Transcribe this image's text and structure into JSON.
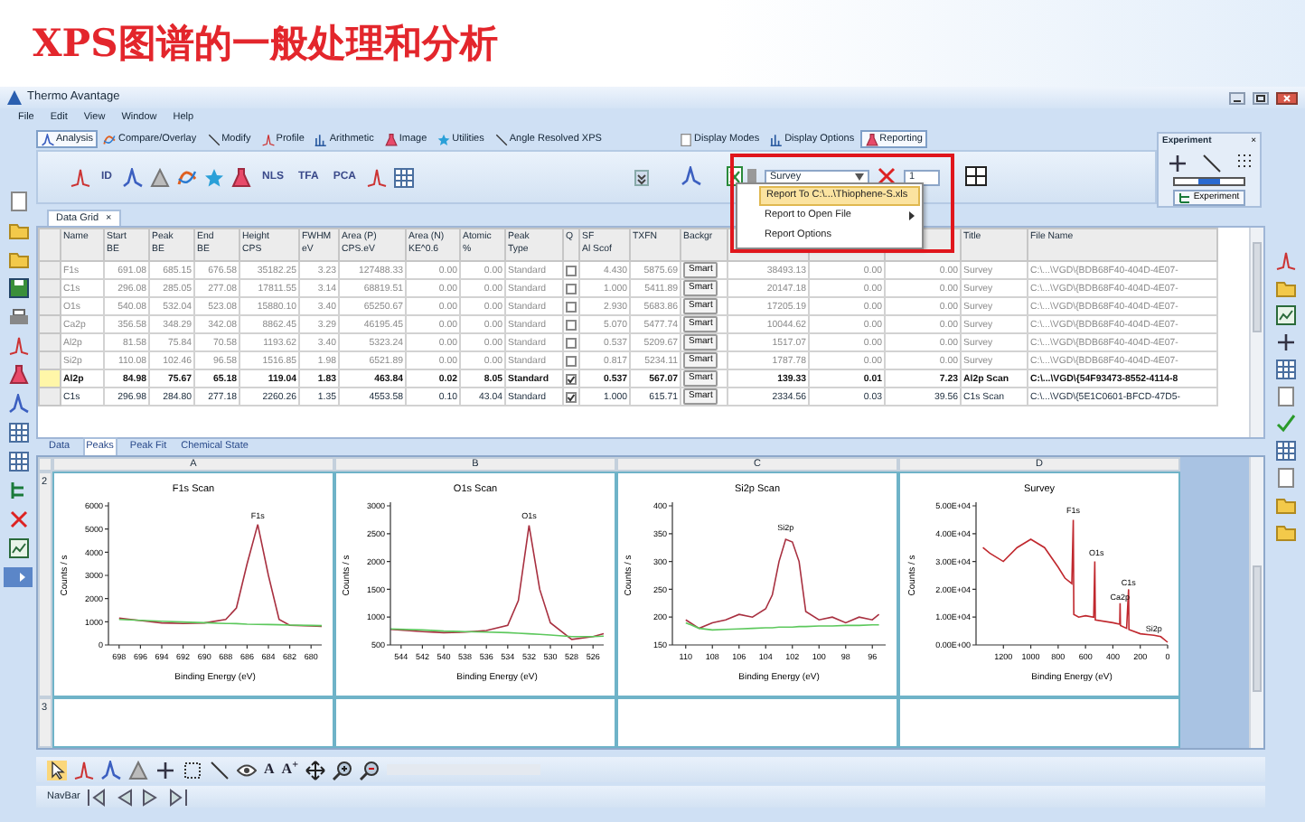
{
  "slide_title": "XPS图谱的一般处理和分析",
  "window": {
    "title": "Thermo Avantage"
  },
  "menu": [
    "File",
    "Edit",
    "View",
    "Window",
    "Help"
  ],
  "ribbon_tabs": [
    {
      "label": "Analysis",
      "selected": true
    },
    {
      "label": "Compare/Overlay",
      "selected": false
    },
    {
      "label": "Modify",
      "selected": false
    },
    {
      "label": "Profile",
      "selected": false
    },
    {
      "label": "Arithmetic",
      "selected": false
    },
    {
      "label": "Image",
      "selected": false
    },
    {
      "label": "Utilities",
      "selected": false
    },
    {
      "label": "Angle Resolved XPS",
      "selected": false
    }
  ],
  "ribbon_tabs_right": [
    {
      "label": "Display Modes",
      "selected": false
    },
    {
      "label": "Display Options",
      "selected": false
    },
    {
      "label": "Reporting",
      "selected": true
    }
  ],
  "toolbar_labels": [
    "ID",
    "NLS",
    "TFA",
    "PCA"
  ],
  "spectrum_dropdown": {
    "value": "Survey"
  },
  "spin_field": {
    "value": "1"
  },
  "report_menu": [
    {
      "label": "Report To C:\\...\\Thiophene-S.xls",
      "highlighted": true,
      "submenu": false
    },
    {
      "label": "Report to Open File",
      "highlighted": false,
      "submenu": true
    },
    {
      "label": "Report Options",
      "highlighted": false,
      "submenu": false
    }
  ],
  "experiment_panel": {
    "title": "Experiment",
    "close": "×",
    "button": "Experiment"
  },
  "document_tab": {
    "label": "Data Grid",
    "close": "×"
  },
  "table": {
    "columns": [
      {
        "lines": [
          "Name"
        ],
        "kind": "text"
      },
      {
        "lines": [
          "Start",
          "BE"
        ],
        "kind": "num"
      },
      {
        "lines": [
          "Peak",
          "BE"
        ],
        "kind": "num"
      },
      {
        "lines": [
          "End",
          "BE"
        ],
        "kind": "num"
      },
      {
        "lines": [
          "Height",
          "CPS"
        ],
        "kind": "num"
      },
      {
        "lines": [
          "FWHM",
          "eV"
        ],
        "kind": "num"
      },
      {
        "lines": [
          "Area (P)",
          "CPS.eV"
        ],
        "kind": "num"
      },
      {
        "lines": [
          "Area (N)",
          "KE^0.6"
        ],
        "kind": "num"
      },
      {
        "lines": [
          "Atomic",
          "%"
        ],
        "kind": "num"
      },
      {
        "lines": [
          "Peak",
          "Type"
        ],
        "kind": "text"
      },
      {
        "lines": [
          "Q"
        ],
        "kind": "check"
      },
      {
        "lines": [
          "SF",
          "Al Scof"
        ],
        "kind": "num"
      },
      {
        "lines": [
          "TXFN"
        ],
        "kind": "num"
      },
      {
        "lines": [
          "Backgr"
        ],
        "kind": "button"
      },
      {
        "kind": "num"
      },
      {
        "kind": "num"
      },
      {
        "kind": "num"
      },
      {
        "lines": [
          "Title"
        ],
        "kind": "text"
      },
      {
        "lines": [
          "File Name"
        ],
        "kind": "text"
      }
    ],
    "rows": [
      {
        "selected": false,
        "dimmed": true,
        "cells": [
          "F1s",
          "691.08",
          "685.15",
          "676.58",
          "35182.25",
          "3.23",
          "127488.33",
          "0.00",
          "0.00",
          "Standard",
          {
            "checked": false
          },
          "4.430",
          "5875.69",
          {
            "button": "Smart"
          },
          "38493.13",
          "0.00",
          "0.00",
          "Survey",
          "C:\\...\\VGD\\{BDB68F40-404D-4E07-"
        ]
      },
      {
        "selected": false,
        "dimmed": true,
        "cells": [
          "C1s",
          "296.08",
          "285.05",
          "277.08",
          "17811.55",
          "3.14",
          "68819.51",
          "0.00",
          "0.00",
          "Standard",
          {
            "checked": false
          },
          "1.000",
          "5411.89",
          {
            "button": "Smart"
          },
          "20147.18",
          "0.00",
          "0.00",
          "Survey",
          "C:\\...\\VGD\\{BDB68F40-404D-4E07-"
        ]
      },
      {
        "selected": false,
        "dimmed": true,
        "cells": [
          "O1s",
          "540.08",
          "532.04",
          "523.08",
          "15880.10",
          "3.40",
          "65250.67",
          "0.00",
          "0.00",
          "Standard",
          {
            "checked": false
          },
          "2.930",
          "5683.86",
          {
            "button": "Smart"
          },
          "17205.19",
          "0.00",
          "0.00",
          "Survey",
          "C:\\...\\VGD\\{BDB68F40-404D-4E07-"
        ]
      },
      {
        "selected": false,
        "dimmed": true,
        "cells": [
          "Ca2p",
          "356.58",
          "348.29",
          "342.08",
          "8862.45",
          "3.29",
          "46195.45",
          "0.00",
          "0.00",
          "Standard",
          {
            "checked": false
          },
          "5.070",
          "5477.74",
          {
            "button": "Smart"
          },
          "10044.62",
          "0.00",
          "0.00",
          "Survey",
          "C:\\...\\VGD\\{BDB68F40-404D-4E07-"
        ]
      },
      {
        "selected": false,
        "dimmed": true,
        "cells": [
          "Al2p",
          "81.58",
          "75.84",
          "70.58",
          "1193.62",
          "3.40",
          "5323.24",
          "0.00",
          "0.00",
          "Standard",
          {
            "checked": false
          },
          "0.537",
          "5209.67",
          {
            "button": "Smart"
          },
          "1517.07",
          "0.00",
          "0.00",
          "Survey",
          "C:\\...\\VGD\\{BDB68F40-404D-4E07-"
        ]
      },
      {
        "selected": false,
        "dimmed": true,
        "cells": [
          "Si2p",
          "110.08",
          "102.46",
          "96.58",
          "1516.85",
          "1.98",
          "6521.89",
          "0.00",
          "0.00",
          "Standard",
          {
            "checked": false
          },
          "0.817",
          "5234.11",
          {
            "button": "Smart"
          },
          "1787.78",
          "0.00",
          "0.00",
          "Survey",
          "C:\\...\\VGD\\{BDB68F40-404D-4E07-"
        ]
      },
      {
        "selected": true,
        "dimmed": false,
        "cells": [
          "Al2p",
          "84.98",
          "75.67",
          "65.18",
          "119.04",
          "1.83",
          "463.84",
          "0.02",
          "8.05",
          "Standard",
          {
            "checked": true
          },
          "0.537",
          "567.07",
          {
            "button": "Smart"
          },
          "139.33",
          "0.01",
          "7.23",
          "Al2p Scan",
          "C:\\...\\VGD\\{54F93473-8552-4114-8"
        ]
      },
      {
        "selected": false,
        "dimmed": false,
        "cells": [
          "C1s",
          "296.98",
          "284.80",
          "277.18",
          "2260.26",
          "1.35",
          "4553.58",
          "0.10",
          "43.04",
          "Standard",
          {
            "checked": true
          },
          "1.000",
          "615.71",
          {
            "button": "Smart"
          },
          "2334.56",
          "0.03",
          "39.56",
          "C1s Scan",
          "C:\\...\\VGD\\{5E1C0601-BFCD-47D5-"
        ]
      }
    ]
  },
  "sheet_tabs": [
    {
      "label": "Data",
      "selected": false
    },
    {
      "label": "Peaks",
      "selected": true
    },
    {
      "label": "Peak Fit",
      "selected": false
    },
    {
      "label": "Chemical State",
      "selected": false
    }
  ],
  "chart_grid": {
    "columns": [
      "A",
      "B",
      "C",
      "D"
    ],
    "rows": [
      {
        "label": "2",
        "charts": [
          {
            "chart_data": {
              "type": "line",
              "title": "F1s Scan",
              "xlabel": "Binding Energy (eV)",
              "ylabel": "Counts / s",
              "x": [
                698,
                696,
                694,
                692,
                690,
                688,
                687,
                686,
                685,
                684,
                683,
                682,
                680,
                679
              ],
              "series": [
                {
                  "color": "#a83040",
                  "values": [
                    1150,
                    1050,
                    950,
                    930,
                    950,
                    1100,
                    1600,
                    3500,
                    5200,
                    3000,
                    1100,
                    850,
                    820,
                    800
                  ]
                },
                {
                  "color": "#5cc85c",
                  "values": [
                    1100,
                    1060,
                    1020,
                    990,
                    960,
                    930,
                    920,
                    900,
                    890,
                    880,
                    870,
                    860,
                    840,
                    830
                  ]
                }
              ],
              "xlim": [
                699,
                679
              ],
              "ylim": [
                0,
                6000
              ],
              "xticks": [
                698,
                696,
                694,
                692,
                690,
                688,
                686,
                684,
                682,
                680
              ],
              "yticks": [
                0,
                1000,
                2000,
                3000,
                4000,
                5000,
                6000
              ],
              "annotations": [
                {
                  "text": "F1s",
                  "x": 685,
                  "y": 5300
                }
              ]
            }
          },
          {
            "chart_data": {
              "type": "line",
              "title": "O1s Scan",
              "xlabel": "Binding Energy (eV)",
              "ylabel": "Counts / s",
              "x": [
                545,
                542,
                540,
                538,
                536,
                534,
                533,
                532,
                531,
                530,
                528,
                526,
                525
              ],
              "series": [
                {
                  "color": "#a83040",
                  "values": [
                    780,
                    740,
                    720,
                    730,
                    760,
                    850,
                    1300,
                    2650,
                    1500,
                    900,
                    600,
                    650,
                    700
                  ]
                },
                {
                  "color": "#5cc85c",
                  "values": [
                    790,
                    770,
                    750,
                    740,
                    730,
                    720,
                    710,
                    700,
                    690,
                    680,
                    650,
                    650,
                    660
                  ]
                }
              ],
              "xlim": [
                545,
                525
              ],
              "ylim": [
                500,
                3000
              ],
              "xticks": [
                544,
                542,
                540,
                538,
                536,
                534,
                532,
                530,
                528,
                526
              ],
              "yticks": [
                500,
                1000,
                1500,
                2000,
                2500,
                3000
              ],
              "annotations": [
                {
                  "text": "O1s",
                  "x": 532,
                  "y": 2700
                }
              ]
            }
          },
          {
            "chart_data": {
              "type": "line",
              "title": "Si2p Scan",
              "xlabel": "Binding Energy (eV)",
              "ylabel": "Counts / s",
              "x": [
                110,
                109,
                108,
                107,
                106,
                105,
                104,
                103.5,
                103,
                102.5,
                102,
                101.5,
                101,
                100,
                99,
                98,
                97,
                96,
                95.5
              ],
              "series": [
                {
                  "color": "#a83040",
                  "values": [
                    195,
                    180,
                    190,
                    195,
                    205,
                    200,
                    215,
                    240,
                    300,
                    340,
                    335,
                    300,
                    210,
                    195,
                    200,
                    190,
                    200,
                    195,
                    205
                  ]
                },
                {
                  "color": "#5cc85c",
                  "values": [
                    190,
                    180,
                    177,
                    178,
                    179,
                    180,
                    181,
                    181,
                    182,
                    182,
                    182,
                    183,
                    183,
                    184,
                    184,
                    185,
                    185,
                    186,
                    186
                  ]
                }
              ],
              "xlim": [
                111,
                95
              ],
              "ylim": [
                150,
                400
              ],
              "xticks": [
                110,
                108,
                106,
                104,
                102,
                100,
                98,
                96
              ],
              "yticks": [
                150,
                200,
                250,
                300,
                350,
                400
              ],
              "annotations": [
                {
                  "text": "Si2p",
                  "x": 102.5,
                  "y": 350
                }
              ]
            }
          },
          {
            "chart_data": {
              "type": "line",
              "title": "Survey",
              "xlabel": "Binding Energy (eV)",
              "ylabel": "Counts / s",
              "x": [
                1350,
                1300,
                1200,
                1100,
                1000,
                900,
                800,
                750,
                700,
                690,
                685,
                650,
                600,
                540,
                532,
                528,
                400,
                350,
                348,
                345,
                300,
                285,
                282,
                200,
                100,
                50,
                0
              ],
              "series": [
                {
                  "color": "#c0282e",
                  "values": [
                    35000,
                    33000,
                    30000,
                    35000,
                    38000,
                    35000,
                    28000,
                    24000,
                    22000,
                    45000,
                    11000,
                    10000,
                    10500,
                    10000,
                    30000,
                    9000,
                    8000,
                    7500,
                    15000,
                    7000,
                    6000,
                    20000,
                    5500,
                    4000,
                    3500,
                    3000,
                    1000
                  ]
                }
              ],
              "xlim": [
                1400,
                0
              ],
              "ylim": [
                0,
                50000
              ],
              "xticks": [
                1200,
                1000,
                800,
                600,
                400,
                200,
                0
              ],
              "yticks": [
                {
                  "value": 0,
                  "label": "0.00E+00"
                },
                {
                  "value": 10000,
                  "label": "1.00E+04"
                },
                {
                  "value": 20000,
                  "label": "2.00E+04"
                },
                {
                  "value": 30000,
                  "label": "3.00E+04"
                },
                {
                  "value": 40000,
                  "label": "4.00E+04"
                },
                {
                  "value": 50000,
                  "label": "5.00E+04"
                }
              ],
              "annotations": [
                {
                  "text": "F1s",
                  "x": 690,
                  "y": 46000
                },
                {
                  "text": "O1s",
                  "x": 520,
                  "y": 31000
                },
                {
                  "text": "Ca2p",
                  "x": 348,
                  "y": 15000
                },
                {
                  "text": "C1s",
                  "x": 285,
                  "y": 20000
                },
                {
                  "text": "Si2p",
                  "x": 100,
                  "y": 3500
                }
              ]
            }
          }
        ]
      },
      {
        "label": "3"
      }
    ]
  },
  "text_tools": [
    "A",
    "A$^{+}$"
  ],
  "navbar": {
    "label": "NavBar"
  }
}
